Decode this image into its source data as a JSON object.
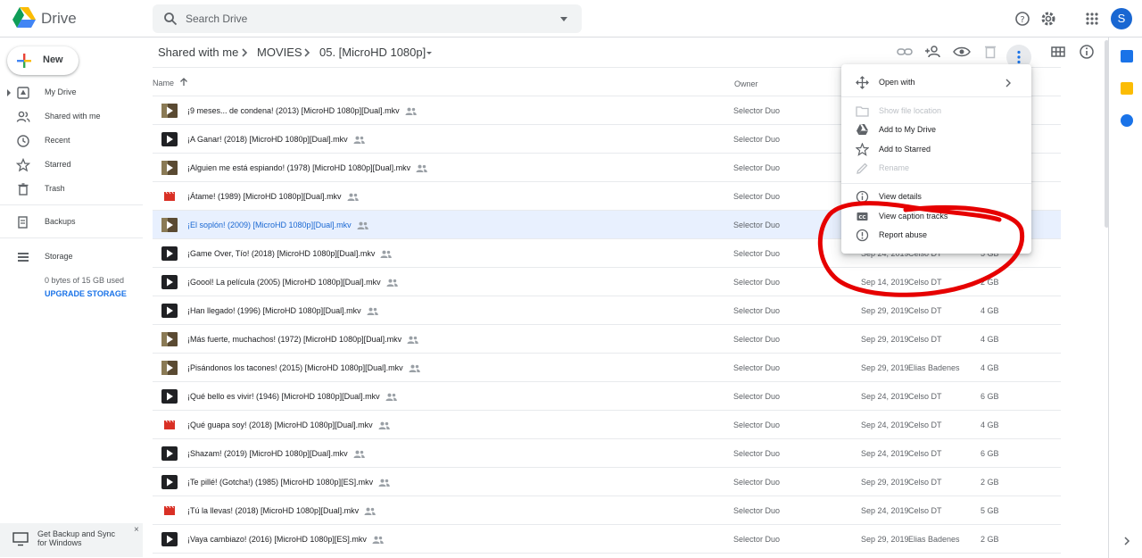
{
  "app": {
    "title": "Drive",
    "avatar_letter": "S",
    "accent": "#1a73e8"
  },
  "search": {
    "placeholder": "Search Drive"
  },
  "topbar": {
    "icons": [
      "help-icon",
      "settings-icon",
      "apps-icon"
    ]
  },
  "sidebar": {
    "new_label": "New",
    "items": [
      {
        "label": "My Drive",
        "icon": "my-drive-icon"
      },
      {
        "label": "Shared with me",
        "icon": "people-icon"
      },
      {
        "label": "Recent",
        "icon": "clock-icon"
      },
      {
        "label": "Starred",
        "icon": "star-icon"
      },
      {
        "label": "Trash",
        "icon": "trash-icon"
      },
      {
        "label": "Backups",
        "icon": "backup-icon"
      },
      {
        "label": "Storage",
        "icon": "storage-icon"
      }
    ],
    "storage_used": "0 bytes of 15 GB used",
    "upgrade": "UPGRADE STORAGE",
    "backup_promo": "Get Backup and Sync for Windows",
    "backup_close": "×"
  },
  "breadcrumb": {
    "items": [
      "Shared with me",
      "MOVIES",
      "05. [MicroHD 1080p]"
    ]
  },
  "table": {
    "col_name": "Name",
    "col_owner": "Owner",
    "rows": [
      {
        "name": "¡9 meses... de condena! (2013) [MicroHD 1080p][Dual].mkv",
        "owner": "Selector Duo",
        "date": "",
        "by": "",
        "size": "",
        "icon": "video-thumb"
      },
      {
        "name": "¡A Ganar! (2018) [MicroHD 1080p][Dual].mkv",
        "owner": "Selector Duo",
        "date": "",
        "by": "",
        "size": "",
        "icon": "video"
      },
      {
        "name": "¡Alguien me está espiando! (1978) [MicroHD 1080p][Dual].mkv",
        "owner": "Selector Duo",
        "date": "",
        "by": "",
        "size": "",
        "icon": "video-thumb"
      },
      {
        "name": "¡Átame! (1989) [MicroHD 1080p][Dual].mkv",
        "owner": "Selector Duo",
        "date": "",
        "by": "",
        "size": "",
        "icon": "video-red"
      },
      {
        "name": "¡El soplón! (2009) [MicroHD 1080p][Dual].mkv",
        "owner": "Selector Duo",
        "date": "",
        "by": "",
        "size": "",
        "icon": "video-thumb",
        "selected": true
      },
      {
        "name": "¡Game Over, Tío! (2018) [MicroHD 1080p][Dual].mkv",
        "owner": "Selector Duo",
        "date": "Sep 24, 2019",
        "by": "Celso DT",
        "size": "5 GB",
        "icon": "video"
      },
      {
        "name": "¡Goool! La película (2005) [MicroHD 1080p][Dual].mkv",
        "owner": "Selector Duo",
        "date": "Sep 14, 2019",
        "by": "Celso DT",
        "size": "2 GB",
        "icon": "video"
      },
      {
        "name": "¡Han llegado! (1996) [MicroHD 1080p][Dual].mkv",
        "owner": "Selector Duo",
        "date": "Sep 29, 2019",
        "by": "Celso DT",
        "size": "4 GB",
        "icon": "video"
      },
      {
        "name": "¡Más fuerte, muchachos! (1972) [MicroHD 1080p][Dual].mkv",
        "owner": "Selector Duo",
        "date": "Sep 29, 2019",
        "by": "Celso DT",
        "size": "4 GB",
        "icon": "video-thumb"
      },
      {
        "name": "¡Pisándonos los tacones! (2015) [MicroHD 1080p][Dual].mkv",
        "owner": "Selector Duo",
        "date": "Sep 29, 2019",
        "by": "Elias Badenes",
        "size": "4 GB",
        "icon": "video-thumb"
      },
      {
        "name": "¡Qué bello es vivir! (1946) [MicroHD 1080p][Dual].mkv",
        "owner": "Selector Duo",
        "date": "Sep 24, 2019",
        "by": "Celso DT",
        "size": "6 GB",
        "icon": "video"
      },
      {
        "name": "¡Qué guapa soy! (2018) [MicroHD 1080p][Dual].mkv",
        "owner": "Selector Duo",
        "date": "Sep 24, 2019",
        "by": "Celso DT",
        "size": "4 GB",
        "icon": "video-red"
      },
      {
        "name": "¡Shazam! (2019) [MicroHD 1080p][Dual].mkv",
        "owner": "Selector Duo",
        "date": "Sep 24, 2019",
        "by": "Celso DT",
        "size": "6 GB",
        "icon": "video"
      },
      {
        "name": "¡Te pillé! (Gotcha!) (1985) [MicroHD 1080p][ES].mkv",
        "owner": "Selector Duo",
        "date": "Sep 29, 2019",
        "by": "Celso DT",
        "size": "2 GB",
        "icon": "video"
      },
      {
        "name": "¡Tú la llevas! (2018) [MicroHD 1080p][Dual].mkv",
        "owner": "Selector Duo",
        "date": "Sep 24, 2019",
        "by": "Celso DT",
        "size": "5 GB",
        "icon": "video-red"
      },
      {
        "name": "¡Vaya cambiazo! (2016) [MicroHD 1080p][ES].mkv",
        "owner": "Selector Duo",
        "date": "Sep 29, 2019",
        "by": "Elias Badenes",
        "size": "2 GB",
        "icon": "video"
      }
    ]
  },
  "context_menu": {
    "items": [
      {
        "label": "Open with",
        "icon": "open-with-icon",
        "disabled": false
      },
      {
        "label": "Show file location",
        "icon": "folder-icon",
        "disabled": true
      },
      {
        "label": "Add to My Drive",
        "icon": "add-to-drive-icon",
        "disabled": false
      },
      {
        "label": "Add to Starred",
        "icon": "star-icon",
        "disabled": false
      },
      {
        "label": "Rename",
        "icon": "pencil-icon",
        "disabled": true
      },
      {
        "label": "View details",
        "icon": "info-icon",
        "disabled": false
      },
      {
        "label": "View caption tracks",
        "icon": "caption-icon",
        "disabled": false
      },
      {
        "label": "Report abuse",
        "icon": "report-icon",
        "disabled": false
      }
    ]
  },
  "annotation_color": "#e60000"
}
